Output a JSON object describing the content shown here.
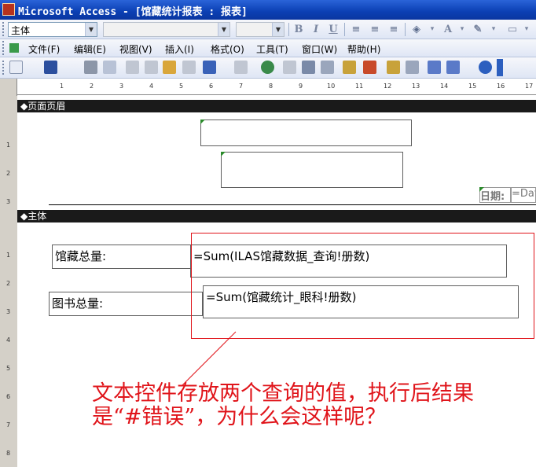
{
  "title_bar": {
    "title": "Microsoft Access - [馆藏统计报表 : 报表]"
  },
  "format_toolbar": {
    "object_combo": "主体",
    "bold": "B",
    "italic": "I",
    "underline": "U",
    "font_color": "A"
  },
  "menu": {
    "items": [
      "文件(F)",
      "编辑(E)",
      "视图(V)",
      "插入(I)",
      "格式(O)",
      "工具(T)",
      "窗口(W)",
      "帮助(H)"
    ]
  },
  "ruler": {
    "ticks": [
      "1",
      "2",
      "3",
      "4",
      "5",
      "6",
      "7",
      "8",
      "9",
      "10",
      "11",
      "12",
      "13",
      "14",
      "15",
      "16",
      "17"
    ]
  },
  "vruler": {
    "header_ticks": [
      "1",
      "2",
      "3"
    ],
    "detail_ticks": [
      "1",
      "2",
      "3",
      "4",
      "5",
      "6",
      "7",
      "8"
    ]
  },
  "sections": {
    "page_header": "◆页面页眉",
    "detail": "◆主体"
  },
  "page_header": {
    "date_label": "日期:",
    "date_value": "=Dat"
  },
  "detail": {
    "label1": "馆藏总量:",
    "text1": "=Sum(ILAS馆藏数据_查询!册数)",
    "label2": "图书总量:",
    "text2": "=Sum(馆藏统计_眼科!册数)"
  },
  "annotation": "文本控件存放两个查询的值，执行后结果是“#错误”，为什么会这样呢？",
  "colors": {
    "title_blue": "#0b3fb3",
    "annotation_red": "#e0141a",
    "band_black": "#1a1a1a"
  }
}
